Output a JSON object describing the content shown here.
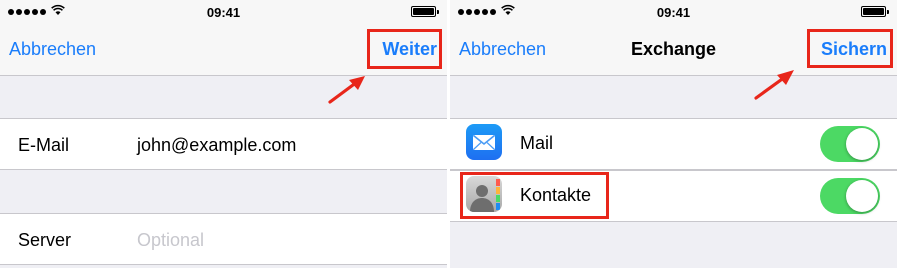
{
  "colors": {
    "accent": "#1a7dfb",
    "highlight": "#e8261a",
    "toggle_on": "#4cd964",
    "grouped_bg": "#efeff4"
  },
  "left": {
    "status": {
      "time": "09:41"
    },
    "nav": {
      "cancel_label": "Abbrechen",
      "next_label": "Weiter"
    },
    "fields": [
      {
        "label": "E-Mail",
        "value": "john@example.com",
        "placeholder": ""
      },
      {
        "label": "Server",
        "value": "",
        "placeholder": "Optional"
      }
    ]
  },
  "right": {
    "status": {
      "time": "09:41"
    },
    "nav": {
      "cancel_label": "Abbrechen",
      "title": "Exchange",
      "save_label": "Sichern"
    },
    "services": [
      {
        "label": "Mail",
        "icon": "mail-icon",
        "enabled": true
      },
      {
        "label": "Kontakte",
        "icon": "contacts-icon",
        "enabled": true
      }
    ]
  }
}
